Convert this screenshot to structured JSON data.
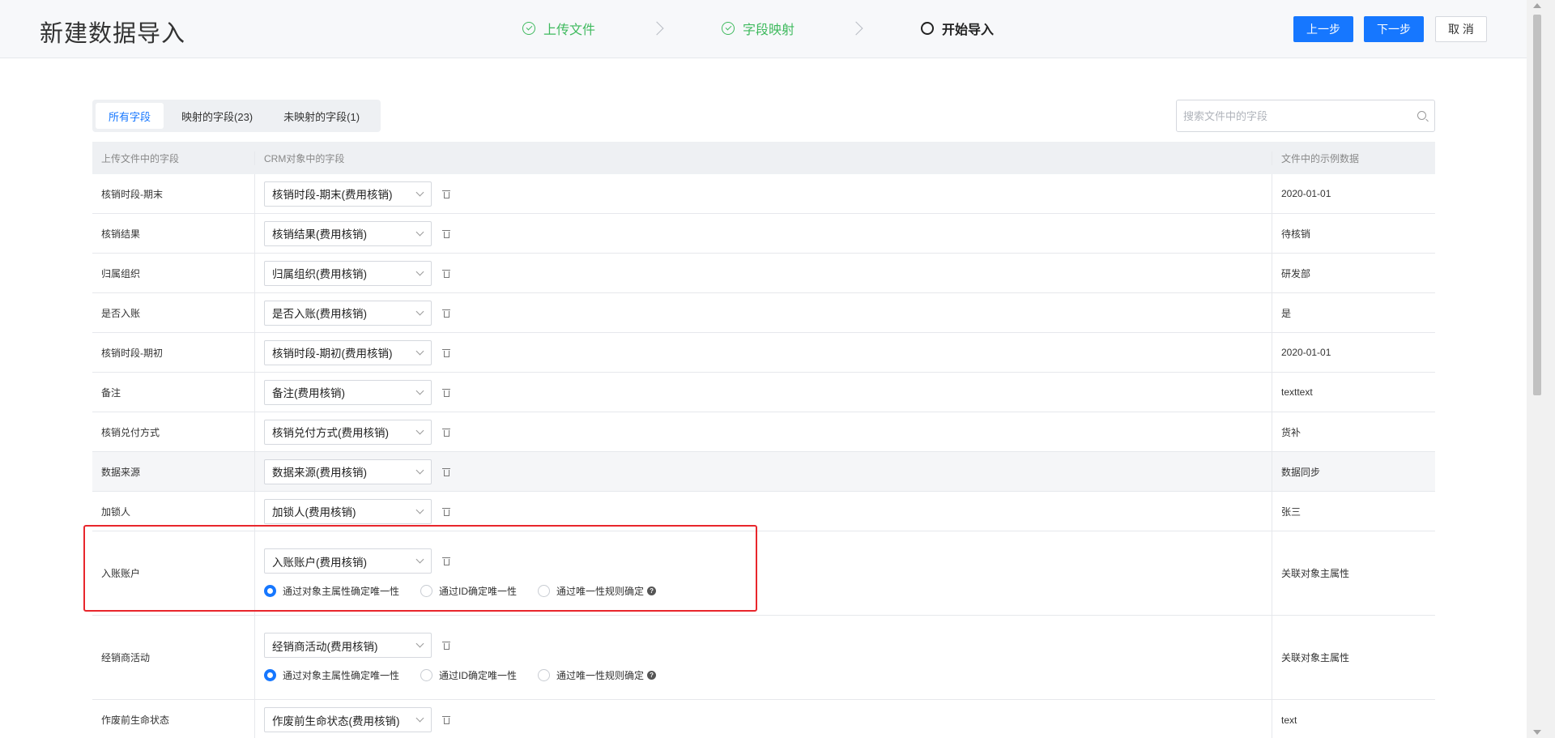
{
  "header": {
    "title": "新建数据导入",
    "steps": [
      {
        "label": "上传文件",
        "status": "done"
      },
      {
        "label": "字段映射",
        "status": "done"
      },
      {
        "label": "开始导入",
        "status": "active"
      }
    ],
    "prev_label": "上一步",
    "next_label": "下一步",
    "cancel_label": "取 消"
  },
  "tabs": [
    {
      "label": "所有字段",
      "active": true
    },
    {
      "label": "映射的字段(23)",
      "active": false
    },
    {
      "label": "未映射的字段(1)",
      "active": false
    }
  ],
  "search": {
    "placeholder": "搜索文件中的字段",
    "value": ""
  },
  "table": {
    "columns": [
      "上传文件中的字段",
      "CRM对象中的字段",
      "文件中的示例数据"
    ],
    "rows": [
      {
        "field": "核销时段-期末",
        "crm": "核销时段-期末(费用核销)",
        "sample": "2020-01-01"
      },
      {
        "field": "核销结果",
        "crm": "核销结果(费用核销)",
        "sample": "待核销"
      },
      {
        "field": "归属组织",
        "crm": "归属组织(费用核销)",
        "sample": "研发部"
      },
      {
        "field": "是否入账",
        "crm": "是否入账(费用核销)",
        "sample": "是"
      },
      {
        "field": "核销时段-期初",
        "crm": "核销时段-期初(费用核销)",
        "sample": "2020-01-01"
      },
      {
        "field": "备注",
        "crm": "备注(费用核销)",
        "sample": "texttext"
      },
      {
        "field": "核销兑付方式",
        "crm": "核销兑付方式(费用核销)",
        "sample": "货补"
      },
      {
        "field": "数据来源",
        "crm": "数据来源(费用核销)",
        "sample": "数据同步"
      },
      {
        "field": "加锁人",
        "crm": "加锁人(费用核销)",
        "sample": "张三"
      },
      {
        "field": "入账账户",
        "crm": "入账账户(费用核销)",
        "sample": "关联对象主属性",
        "radios": [
          "通过对象主属性确定唯一性",
          "通过ID确定唯一性",
          "通过唯一性规则确定"
        ]
      },
      {
        "field": "经销商活动",
        "crm": "经销商活动(费用核销)",
        "sample": "关联对象主属性",
        "radios": [
          "通过对象主属性确定唯一性",
          "通过ID确定唯一性",
          "通过唯一性规则确定"
        ]
      },
      {
        "field": "作废前生命状态",
        "crm": "作废前生命状态(费用核销)",
        "sample": "text"
      }
    ]
  },
  "colors": {
    "primary": "#1677ff",
    "success": "#3fba5e",
    "annotation": "#e8262c"
  }
}
